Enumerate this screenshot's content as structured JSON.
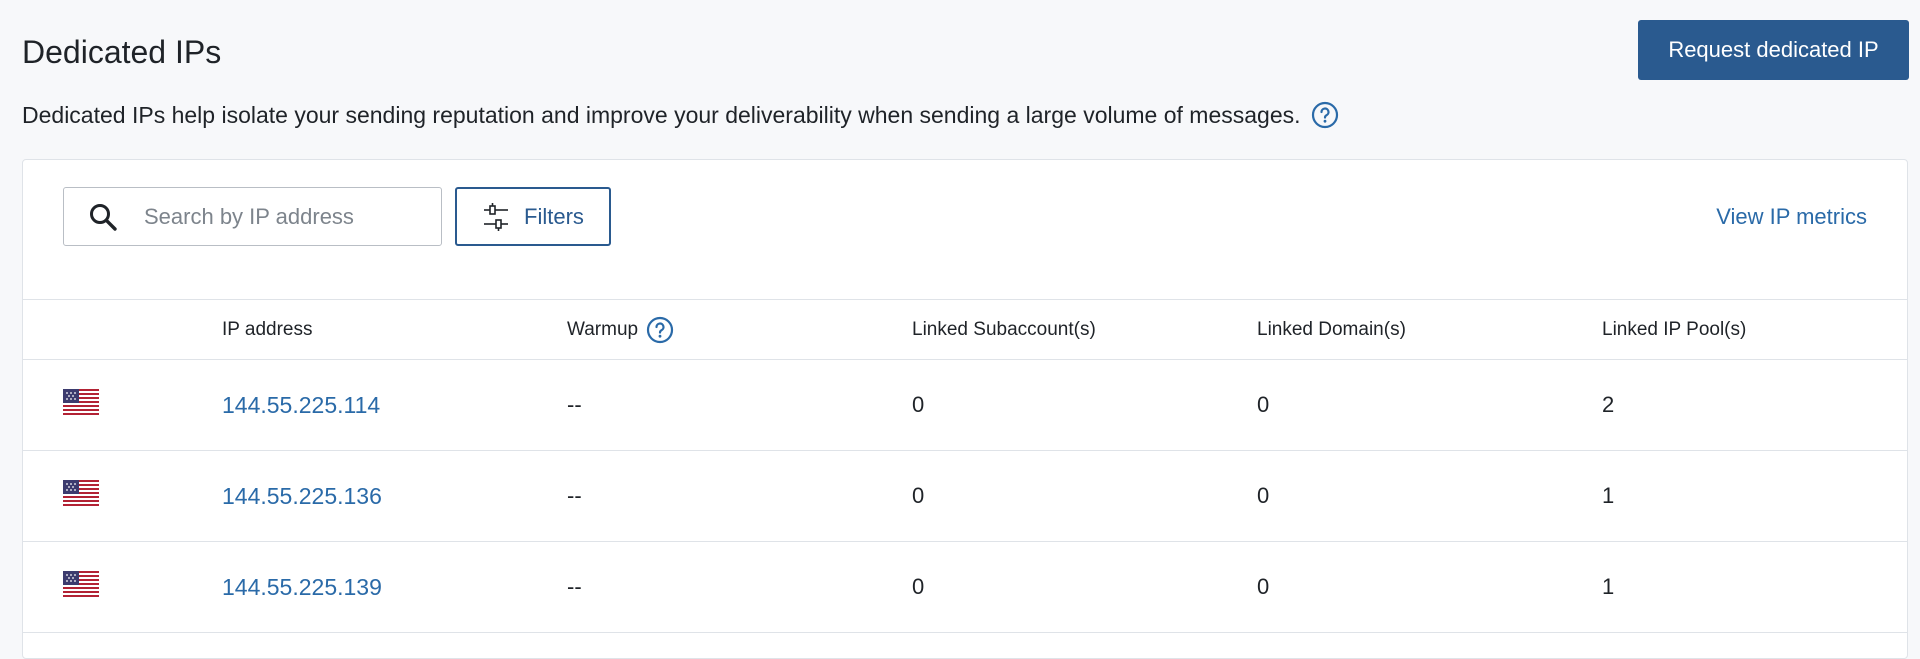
{
  "header": {
    "title": "Dedicated IPs",
    "request_button_label": "Request dedicated IP",
    "description": "Dedicated IPs help isolate your sending reputation and improve your deliverability when sending a large volume of messages."
  },
  "toolbar": {
    "search_placeholder": "Search by IP address",
    "search_value": "",
    "filters_label": "Filters",
    "view_metrics_label": "View IP metrics"
  },
  "table": {
    "columns": [
      "IP address",
      "Warmup",
      "Linked Subaccount(s)",
      "Linked Domain(s)",
      "Linked IP Pool(s)"
    ],
    "rows": [
      {
        "country": "us-flag-icon",
        "ip": "144.55.225.114",
        "warmup": "--",
        "subaccounts": "0",
        "domains": "0",
        "pools": "2"
      },
      {
        "country": "us-flag-icon",
        "ip": "144.55.225.136",
        "warmup": "--",
        "subaccounts": "0",
        "domains": "0",
        "pools": "1"
      },
      {
        "country": "us-flag-icon",
        "ip": "144.55.225.139",
        "warmup": "--",
        "subaccounts": "0",
        "domains": "0",
        "pools": "1"
      }
    ]
  },
  "colors": {
    "primary": "#2a5a8f",
    "link": "#2a6aa8",
    "border": "#dfe3e8",
    "background": "#f7f8fa"
  }
}
